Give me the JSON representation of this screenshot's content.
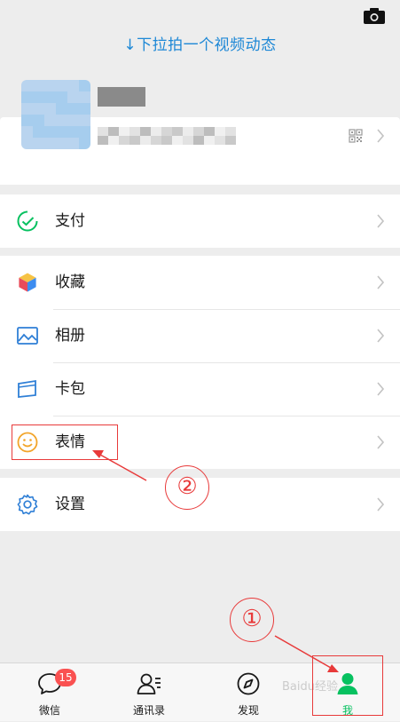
{
  "header": {
    "pull_hint": "↓下拉拍一个视频动态",
    "camera_icon": "camera-icon"
  },
  "profile": {
    "avatar": "avatar-pixelated",
    "nickname": "",
    "wechat_id": "",
    "qr_icon": "qr-code-icon",
    "chevron_icon": "chevron-right-icon"
  },
  "menu": {
    "groups": [
      {
        "items": [
          {
            "label": "支付",
            "icon": "wallet-icon"
          }
        ]
      },
      {
        "items": [
          {
            "label": "收藏",
            "icon": "favorites-cube-icon"
          },
          {
            "label": "相册",
            "icon": "album-icon"
          },
          {
            "label": "卡包",
            "icon": "card-icon"
          },
          {
            "label": "表情",
            "icon": "sticker-smile-icon"
          }
        ]
      },
      {
        "items": [
          {
            "label": "设置",
            "icon": "gear-icon"
          }
        ]
      }
    ]
  },
  "tabbar": {
    "tabs": [
      {
        "label": "微信",
        "icon": "chat-bubble-icon",
        "badge": "15",
        "active": false
      },
      {
        "label": "通讯录",
        "icon": "contacts-icon",
        "active": false
      },
      {
        "label": "发现",
        "icon": "compass-icon",
        "active": false
      },
      {
        "label": "我",
        "icon": "me-person-icon",
        "active": true
      }
    ]
  },
  "annotations": {
    "step_1": "①",
    "step_2": "②"
  },
  "watermark": "Baidu经验",
  "colors": {
    "accent_green": "#07c160",
    "link_blue": "#1e88d6",
    "annotation_red": "#e83a3a",
    "badge_red": "#fa5151"
  }
}
